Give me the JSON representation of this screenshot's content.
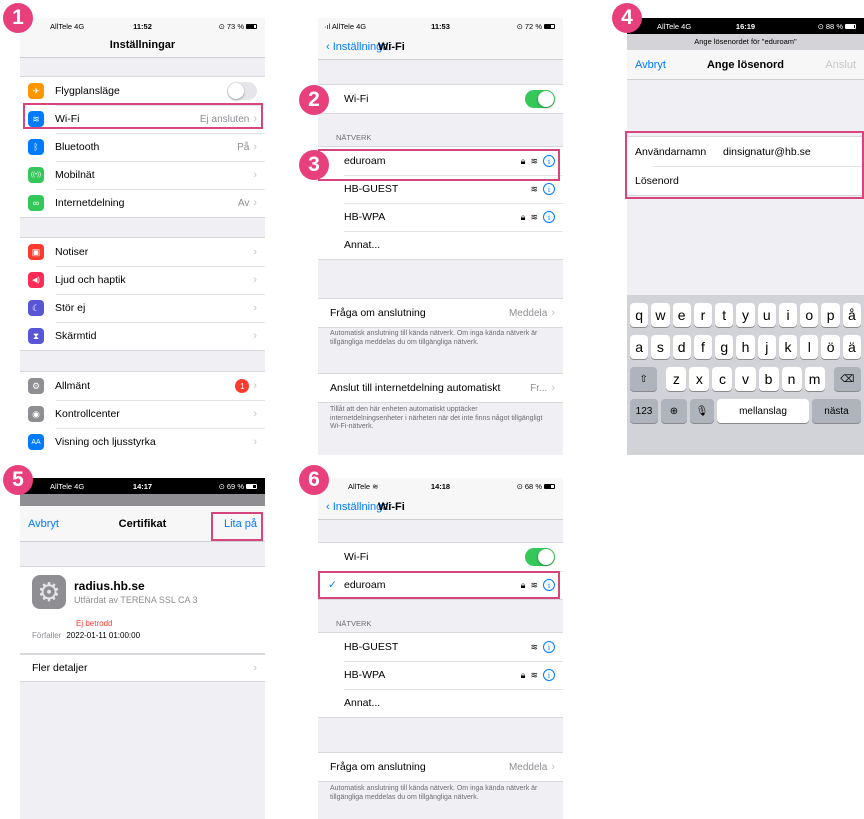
{
  "steps": [
    "1",
    "2",
    "3",
    "4",
    "5",
    "6"
  ],
  "s1": {
    "carrier": "AllTele 4G",
    "time": "11:52",
    "battery": "73 %",
    "title": "Inställningar",
    "g1": [
      {
        "label": "Flygplansläge",
        "color": "#ff9500",
        "icon": "airplane-icon",
        "glyph": "✈"
      },
      {
        "label": "Wi-Fi",
        "value": "Ej ansluten",
        "color": "#007aff",
        "icon": "wifi-icon",
        "glyph": "≋"
      },
      {
        "label": "Bluetooth",
        "value": "På",
        "color": "#007aff",
        "icon": "bluetooth-icon",
        "glyph": "ᛒ"
      },
      {
        "label": "Mobilnät",
        "value": "",
        "color": "#34c759",
        "icon": "antenna-icon",
        "glyph": "((•))"
      },
      {
        "label": "Internetdelning",
        "value": "Av",
        "color": "#34c759",
        "icon": "link-icon",
        "glyph": "∞"
      }
    ],
    "g2": [
      {
        "label": "Notiser",
        "color": "#ff3b30",
        "icon": "notifications-icon",
        "glyph": "▣"
      },
      {
        "label": "Ljud och haptik",
        "color": "#ff2d55",
        "icon": "speaker-icon",
        "glyph": "◀)"
      },
      {
        "label": "Stör ej",
        "color": "#5856d6",
        "icon": "moon-icon",
        "glyph": "☾"
      },
      {
        "label": "Skärmtid",
        "color": "#5856d6",
        "icon": "hourglass-icon",
        "glyph": "⧗"
      }
    ],
    "g3": [
      {
        "label": "Allmänt",
        "badge": "1",
        "color": "#8e8e93",
        "icon": "gear-icon",
        "glyph": "⚙"
      },
      {
        "label": "Kontrollcenter",
        "color": "#8e8e93",
        "icon": "toggles-icon",
        "glyph": "◉"
      },
      {
        "label": "Visning och ljusstyrka",
        "color": "#007aff",
        "icon": "text-size-icon",
        "glyph": "AA"
      }
    ]
  },
  "s2": {
    "carrier": "AllTele 4G",
    "time": "11:53",
    "battery": "72 %",
    "back": "Inställningar",
    "title": "Wi-Fi",
    "wifi": "Wi-Fi",
    "section": "NÄTVERK",
    "networks": [
      "eduroam",
      "HB-GUEST",
      "HB-WPA"
    ],
    "other": "Annat...",
    "ask": "Fråga om anslutning",
    "ask_val": "Meddela",
    "ask_foot": "Automatisk anslutning till kända nätverk. Om inga kända nätverk är tillgängliga meddelas du om tillgängliga nätverk.",
    "hotspot": "Anslut till internetdelning automatiskt",
    "hotspot_val": "Fr...",
    "hotspot_foot": "Tillåt att den här enheten automatiskt upptäcker internetdelningsenheter i närheten när det inte finns något tillgängligt Wi-Fi-nätverk."
  },
  "s4": {
    "carrier": "AllTele 4G",
    "time": "16:19",
    "battery": "88 %",
    "prompt": "Ange lösenordet för \"eduroam\"",
    "cancel": "Avbryt",
    "title": "Ange lösenord",
    "join": "Anslut",
    "user_label": "Användarnamn",
    "user_value": "dinsignatur@hb.se",
    "pass_label": "Lösenord",
    "row1": [
      "q",
      "w",
      "e",
      "r",
      "t",
      "y",
      "u",
      "i",
      "o",
      "p",
      "å"
    ],
    "row2": [
      "a",
      "s",
      "d",
      "f",
      "g",
      "h",
      "j",
      "k",
      "l",
      "ö",
      "ä"
    ],
    "row3": [
      "z",
      "x",
      "c",
      "v",
      "b",
      "n",
      "m"
    ],
    "num": "123",
    "space": "mellanslag",
    "next": "nästa"
  },
  "s5": {
    "carrier": "AllTele 4G",
    "time": "14:17",
    "battery": "69 %",
    "cancel": "Avbryt",
    "title": "Certifikat",
    "trust": "Lita på",
    "cert_name": "radius.hb.se",
    "issuer": "Utfärdat av TERENA SSL CA 3",
    "untrusted": "Ej betrodd",
    "expires_label": "Förfaller",
    "expires": "2022-01-11 01:00:00",
    "more": "Fler detaljer"
  },
  "s6": {
    "carrier": "AllTele",
    "time": "14:18",
    "battery": "68 %",
    "back": "Inställningar",
    "title": "Wi-Fi",
    "wifi": "Wi-Fi",
    "connected": "eduroam",
    "section": "NÄTVERK",
    "networks": [
      "HB-GUEST",
      "HB-WPA"
    ],
    "other": "Annat...",
    "ask": "Fråga om anslutning",
    "ask_val": "Meddela",
    "ask_foot": "Automatisk anslutning till kända nätverk. Om inga kända nätverk är tillgängliga meddelas du om tillgängliga nätverk."
  },
  "colors": {
    "accent": "#007aff",
    "highlight": "#d6457e",
    "step": "#e8407c",
    "toggle_on": "#34c759"
  }
}
